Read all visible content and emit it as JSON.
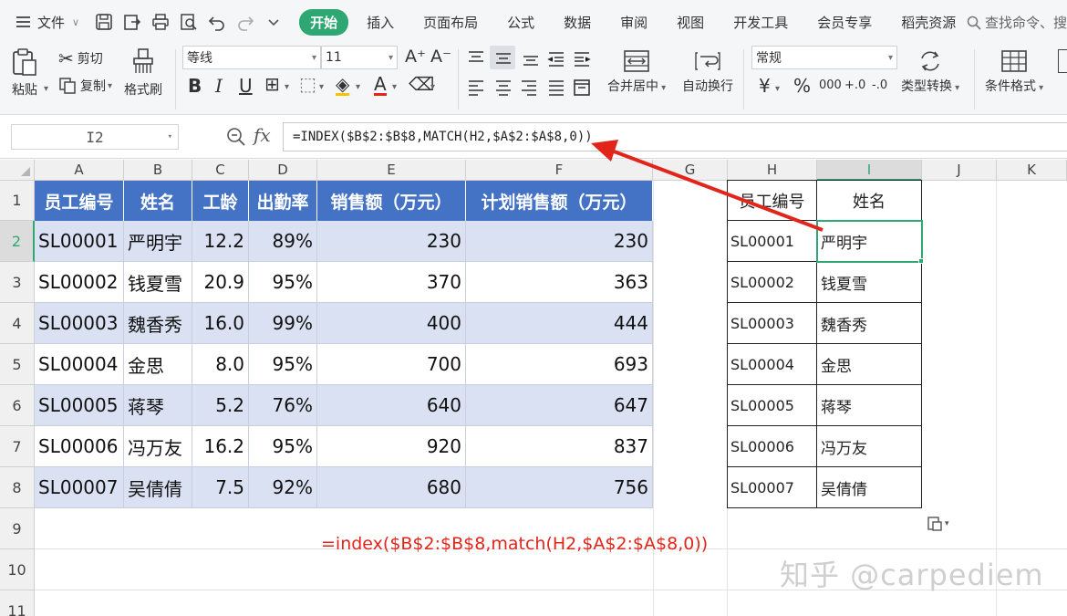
{
  "menu": {
    "file_label": "文件",
    "tabs": [
      "开始",
      "插入",
      "页面布局",
      "公式",
      "数据",
      "审阅",
      "视图",
      "开发工具",
      "会员专享",
      "稻壳资源"
    ],
    "search_text": "查找命令、搜"
  },
  "ribbon": {
    "paste": "粘贴",
    "cut": "剪切",
    "copy": "复制",
    "format_painter": "格式刷",
    "font_name": "等线",
    "font_size": "11",
    "merge_center": "合并居中",
    "wrap_text": "自动换行",
    "number_format": "常规",
    "type_convert": "类型转换",
    "conditional_format": "条件格式",
    "currency_symbol": "¥",
    "percent_symbol": "%",
    "thousands_symbol": "000",
    "dec_inc": "+.0",
    "dec_dec": "-.0"
  },
  "formula_bar": {
    "name_box": "I2",
    "fx": "fx",
    "formula": "=INDEX($B$2:$B$8,MATCH(H2,$A$2:$A$8,0))"
  },
  "columns": [
    "A",
    "B",
    "C",
    "D",
    "E",
    "F",
    "G",
    "H",
    "I",
    "J",
    "K"
  ],
  "rows": [
    "1",
    "2",
    "3",
    "4",
    "5",
    "6",
    "7",
    "8",
    "9",
    "10",
    "11"
  ],
  "table": {
    "headers": [
      "员工编号",
      "姓名",
      "工龄",
      "出勤率",
      "销售额（万元）",
      "计划销售额（万元）"
    ],
    "rows": [
      [
        "SL00001",
        "严明宇",
        "12.2",
        "89%",
        "230",
        "230"
      ],
      [
        "SL00002",
        "钱夏雪",
        "20.9",
        "95%",
        "370",
        "363"
      ],
      [
        "SL00003",
        "魏香秀",
        "16.0",
        "99%",
        "400",
        "444"
      ],
      [
        "SL00004",
        "金思",
        "8.0",
        "95%",
        "700",
        "693"
      ],
      [
        "SL00005",
        "蒋琴",
        "5.2",
        "76%",
        "640",
        "647"
      ],
      [
        "SL00006",
        "冯万友",
        "16.2",
        "95%",
        "920",
        "837"
      ],
      [
        "SL00007",
        "吴倩倩",
        "7.5",
        "92%",
        "680",
        "756"
      ]
    ]
  },
  "lookup": {
    "headers": [
      "员工编号",
      "姓名"
    ],
    "rows": [
      [
        "SL00001",
        "严明宇"
      ],
      [
        "SL00002",
        "钱夏雪"
      ],
      [
        "SL00003",
        "魏香秀"
      ],
      [
        "SL00004",
        "金思"
      ],
      [
        "SL00005",
        "蒋琴"
      ],
      [
        "SL00006",
        "冯万友"
      ],
      [
        "SL00007",
        "吴倩倩"
      ]
    ]
  },
  "annotation": {
    "formula_note": "=index($B$2:$B$8,match(H2,$A$2:$A$8,0))",
    "watermark": "知乎 @carpediem"
  },
  "colors": {
    "accent": "#2fa772",
    "header_fill": "#4472c4",
    "band_fill": "#d9e1f2",
    "arrow": "#e1251b"
  }
}
